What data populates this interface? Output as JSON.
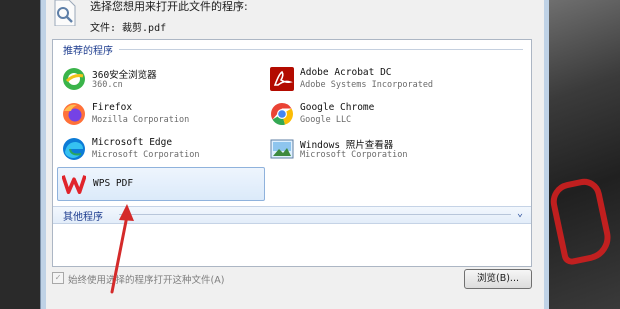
{
  "dialog": {
    "prompt": "选择您想用来打开此文件的程序:",
    "file_line": "文件: 裁剪.pdf"
  },
  "recommended": {
    "title": "推荐的程序",
    "apps": [
      {
        "name": "360安全浏览器",
        "publisher": "360.cn",
        "icon": "360-browser-icon",
        "color": "#3ab44a"
      },
      {
        "name": "Adobe Acrobat DC",
        "publisher": "Adobe Systems Incorporated",
        "icon": "acrobat-icon",
        "color": "#b30b00"
      },
      {
        "name": "Firefox",
        "publisher": "Mozilla Corporation",
        "icon": "firefox-icon",
        "color": "#ff7139"
      },
      {
        "name": "Google Chrome",
        "publisher": "Google LLC",
        "icon": "chrome-icon",
        "color": "#4285f4"
      },
      {
        "name": "Microsoft Edge",
        "publisher": "Microsoft Corporation",
        "icon": "edge-icon",
        "color": "#0c7bd6"
      },
      {
        "name": "Windows 照片查看器",
        "publisher": "Microsoft Corporation",
        "icon": "photo-viewer-icon",
        "color": "#3a7bbf"
      },
      {
        "name": "WPS PDF",
        "publisher": "",
        "icon": "wps-pdf-icon",
        "color": "#e0242b"
      }
    ]
  },
  "other": {
    "title": "其他程序"
  },
  "always_checkbox": {
    "checked": true,
    "label": "始终使用选择的程序打开这种文件(A)"
  },
  "browse_button": {
    "label": "浏览(B)..."
  },
  "colors": {
    "accent_text": "#1e3d8f",
    "annotation_arrow": "#d42a2a"
  }
}
